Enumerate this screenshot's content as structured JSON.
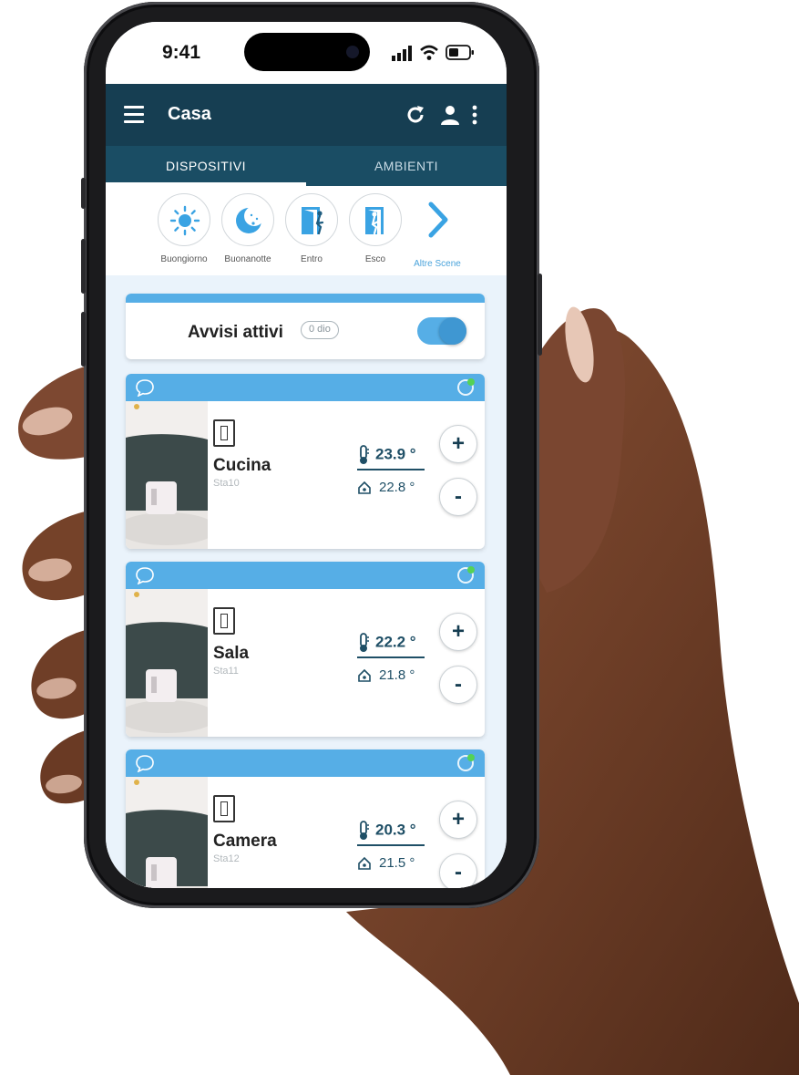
{
  "status_bar": {
    "time": "9:41"
  },
  "app_bar": {
    "title": "Casa"
  },
  "tabs": [
    {
      "label": "DISPOSITIVI",
      "active": true
    },
    {
      "label": "AMBIENTI",
      "active": false
    }
  ],
  "scenes": [
    {
      "label": "Buongiorno",
      "icon": "sun-icon"
    },
    {
      "label": "Buonanotte",
      "icon": "moon-icon"
    },
    {
      "label": "Entro",
      "icon": "door-enter-icon"
    },
    {
      "label": "Esco",
      "icon": "door-exit-icon"
    }
  ],
  "scenes_more": {
    "label": "Altre Scene",
    "icon": "chevron-right-icon"
  },
  "alerts": {
    "label": "Avvisi attivi",
    "badge": "0 dio",
    "enabled": true
  },
  "devices": [
    {
      "name": "Cucina",
      "code": "Sta10",
      "set_temp": "23.9 °",
      "room_temp": "22.8 °",
      "plus": "+",
      "minus": "-"
    },
    {
      "name": "Sala",
      "code": "Sta11",
      "set_temp": "22.2 °",
      "room_temp": "21.8 °",
      "plus": "+",
      "minus": "-"
    },
    {
      "name": "Camera",
      "code": "Sta12",
      "set_temp": "20.3 °",
      "room_temp": "21.5 °",
      "plus": "+",
      "minus": "-"
    }
  ],
  "colors": {
    "app_bar": "#163e52",
    "tab_bar": "#1a4d64",
    "accent": "#56aee6",
    "online": "#54d256",
    "temperature_text": "#1f4f66"
  }
}
